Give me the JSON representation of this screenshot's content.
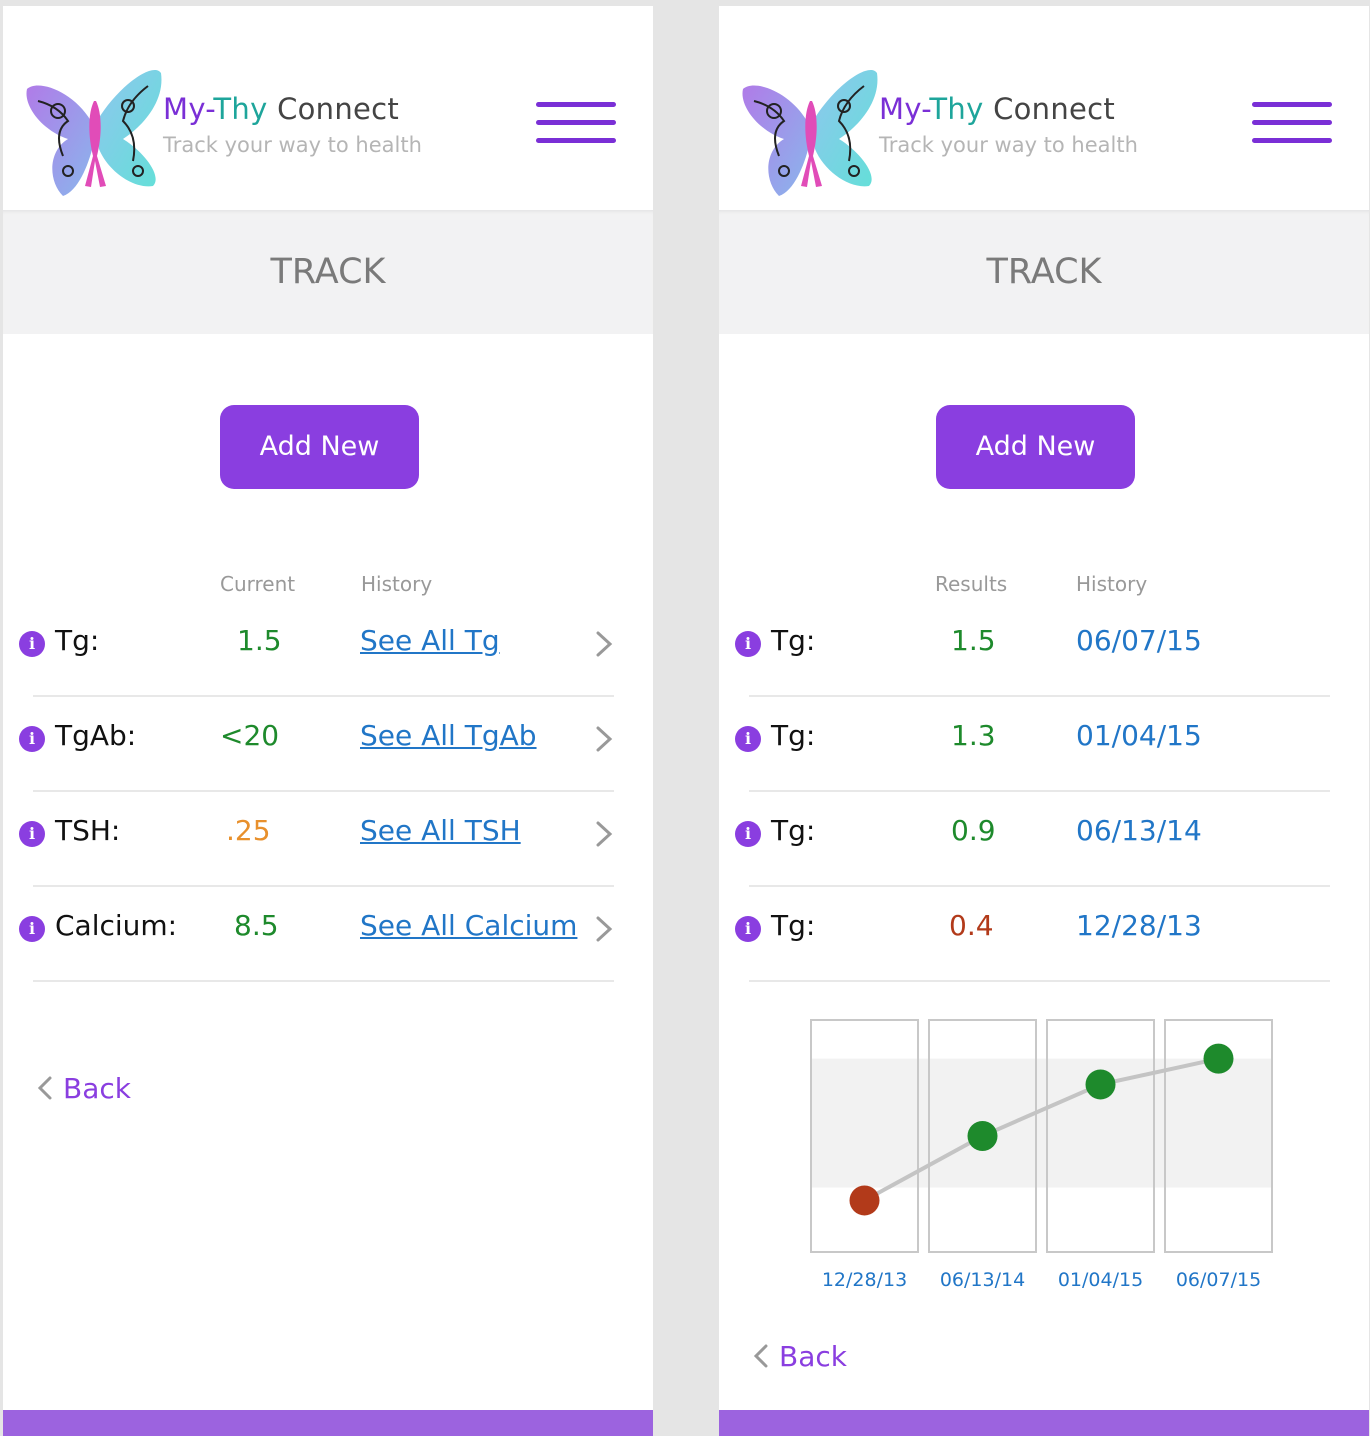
{
  "brand": {
    "name_my": "My-",
    "name_thy": "Thy",
    "name_rest": " Connect",
    "tagline": "Track your way to health"
  },
  "colors": {
    "primary_purple": "#8a3ee0",
    "teal": "#1ea59b",
    "link_blue": "#2176c7",
    "value_green": "#1e8a2c",
    "value_orange": "#e8902c",
    "value_red": "#b23a1a",
    "footer_purple": "#9c63df"
  },
  "left": {
    "page_title": "TRACK",
    "add_button_label": "Add New",
    "col_current": "Current",
    "col_history": "History",
    "rows": [
      {
        "label": "Tg:",
        "value": "1.5",
        "value_status": "green",
        "link": "See All Tg"
      },
      {
        "label": "TgAb:",
        "value": "<20",
        "value_status": "green",
        "link": "See All TgAb"
      },
      {
        "label": "TSH:",
        "value": ".25",
        "value_status": "orange",
        "link": "See All TSH"
      },
      {
        "label": "Calcium:",
        "value": "8.5",
        "value_status": "green",
        "link": "See All Calcium"
      }
    ],
    "back_label": "Back"
  },
  "right": {
    "page_title": "TRACK",
    "add_button_label": "Add New",
    "col_results": "Results",
    "col_history": "History",
    "rows": [
      {
        "label": "Tg:",
        "value": "1.5",
        "value_status": "green",
        "date": "06/07/15"
      },
      {
        "label": "Tg:",
        "value": "1.3",
        "value_status": "green",
        "date": "01/04/15"
      },
      {
        "label": "Tg:",
        "value": "0.9",
        "value_status": "green",
        "date": "06/13/14"
      },
      {
        "label": "Tg:",
        "value": "0.4",
        "value_status": "red",
        "date": "12/28/13"
      }
    ],
    "back_label": "Back"
  },
  "icons": {
    "info": "info-icon",
    "chevron": "chevron-right-icon",
    "back": "chevron-left-icon",
    "menu": "hamburger-menu-icon",
    "logo": "butterfly-logo"
  },
  "chart_data": {
    "type": "line",
    "title": "",
    "xlabel": "",
    "ylabel": "",
    "categories": [
      "12/28/13",
      "06/13/14",
      "01/04/15",
      "06/07/15"
    ],
    "values": [
      0.4,
      0.9,
      1.3,
      1.5
    ],
    "point_status": [
      "red",
      "green",
      "green",
      "green"
    ],
    "ylim": [
      0.0,
      1.8
    ],
    "reference_band": [
      0.5,
      1.5
    ],
    "grid": false,
    "legend": "none"
  }
}
